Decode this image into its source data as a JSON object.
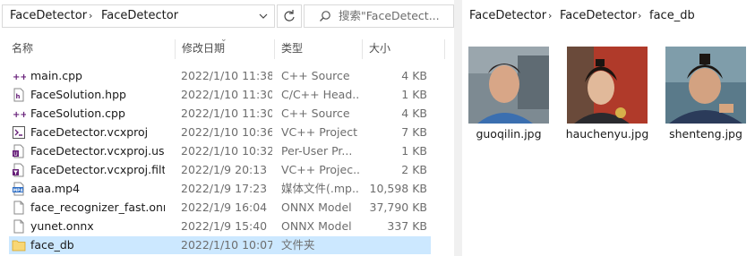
{
  "left_pane": {
    "breadcrumb": [
      "FaceDetector",
      "FaceDetector"
    ],
    "search_placeholder": "搜索\"FaceDetect...",
    "columns": {
      "name": "名称",
      "date": "修改日期",
      "type": "类型",
      "size": "大小"
    },
    "files": [
      {
        "name": "main.cpp",
        "date": "2022/1/10 11:38",
        "type": "C++ Source",
        "size": "4 KB",
        "icon": "cpp-source-icon"
      },
      {
        "name": "FaceSolution.hpp",
        "date": "2022/1/10 11:30",
        "type": "C/C++ Head...",
        "size": "1 KB",
        "icon": "header-file-icon"
      },
      {
        "name": "FaceSolution.cpp",
        "date": "2022/1/10 11:30",
        "type": "C++ Source",
        "size": "4 KB",
        "icon": "cpp-source-icon"
      },
      {
        "name": "FaceDetector.vcxproj",
        "date": "2022/1/10 10:36",
        "type": "VC++ Project",
        "size": "7 KB",
        "icon": "vcxproj-icon"
      },
      {
        "name": "FaceDetector.vcxproj.user",
        "date": "2022/1/10 10:32",
        "type": "Per-User Pr...",
        "size": "1 KB",
        "icon": "vcxproj-user-icon"
      },
      {
        "name": "FaceDetector.vcxproj.filte...",
        "date": "2022/1/9 20:13",
        "type": "VC++ Projec...",
        "size": "2 KB",
        "icon": "vcxproj-filters-icon"
      },
      {
        "name": "aaa.mp4",
        "date": "2022/1/9 17:23",
        "type": "媒体文件(.mp...",
        "size": "10,598 KB",
        "icon": "mp4-file-icon"
      },
      {
        "name": "face_recognizer_fast.onnx",
        "date": "2022/1/9 16:04",
        "type": "ONNX Model",
        "size": "37,790 KB",
        "icon": "blank-file-icon"
      },
      {
        "name": "yunet.onnx",
        "date": "2022/1/9 15:40",
        "type": "ONNX Model",
        "size": "337 KB",
        "icon": "blank-file-icon"
      },
      {
        "name": "face_db",
        "date": "2022/1/10 10:07",
        "type": "文件夹",
        "size": "",
        "icon": "folder-icon"
      }
    ]
  },
  "right_pane": {
    "breadcrumb": [
      "FaceDetector",
      "FaceDetector",
      "face_db"
    ],
    "images": [
      {
        "name": "guoqilin.jpg",
        "icon": "photo-thumbnail"
      },
      {
        "name": "hauchenyu.jpg",
        "icon": "photo-thumbnail"
      },
      {
        "name": "shenteng.jpg",
        "icon": "photo-thumbnail"
      }
    ]
  },
  "colors": {
    "selection": "#cce8ff",
    "divider": "#f0f0f0",
    "cpp_icon": "#68217a",
    "folder": "#f8d775"
  }
}
